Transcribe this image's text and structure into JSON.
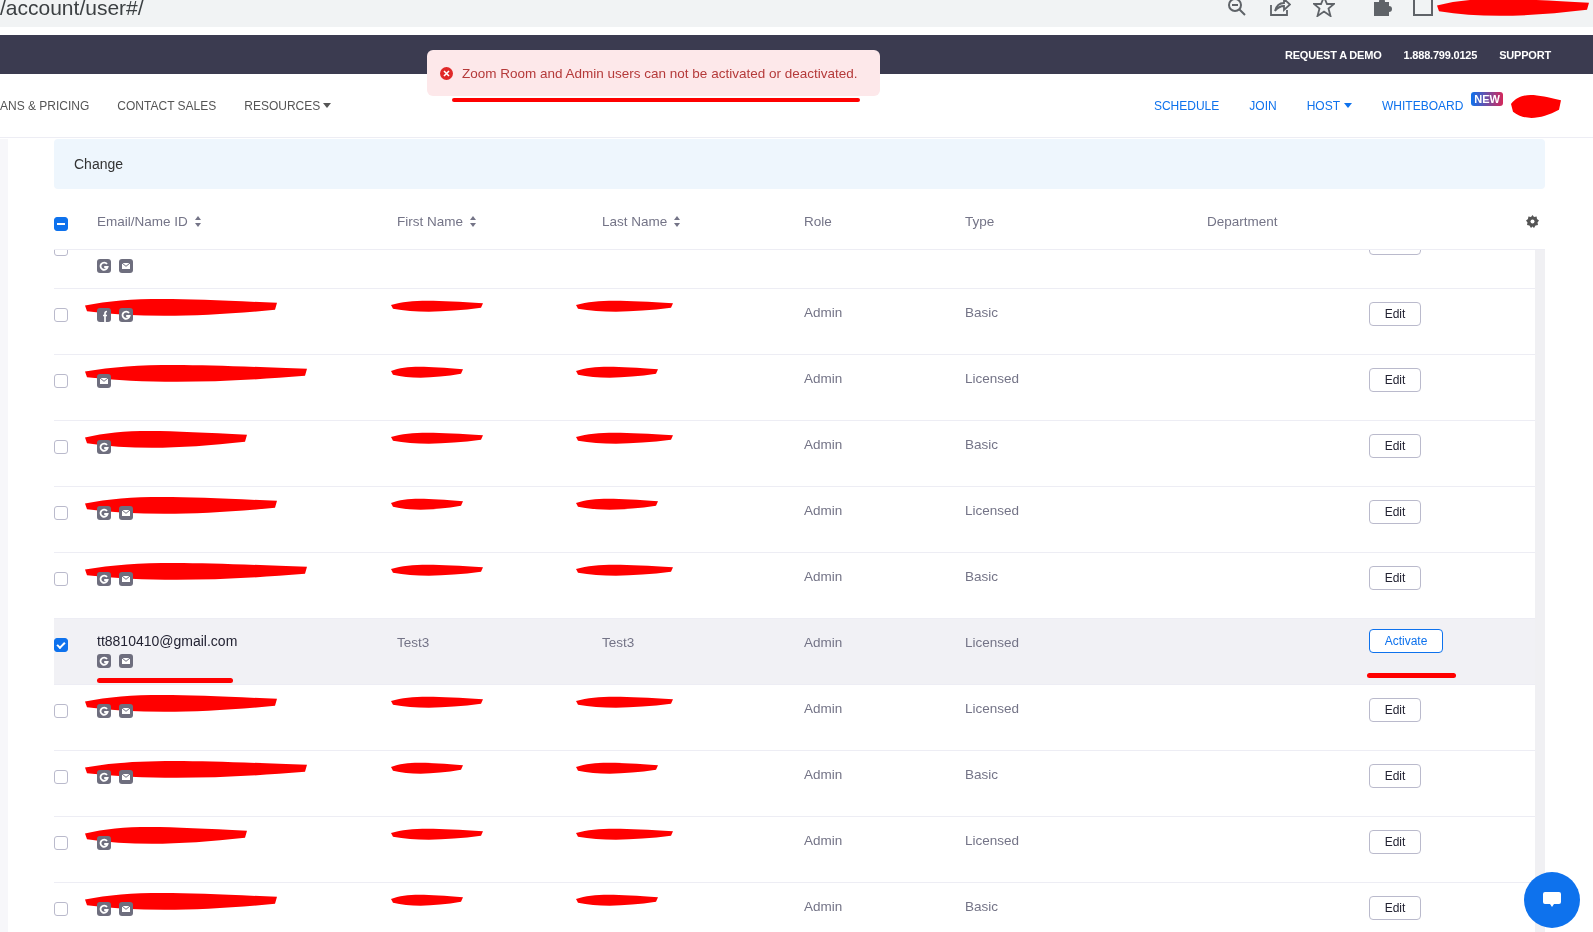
{
  "browser": {
    "url": "/account/user#/",
    "redacted": true
  },
  "top_bar": {
    "links": [
      "REQUEST A DEMO",
      "1.888.799.0125",
      "SUPPORT"
    ]
  },
  "nav": {
    "left": [
      {
        "label": "ANS & PRICING",
        "dropdown": false
      },
      {
        "label": "CONTACT SALES",
        "dropdown": false
      },
      {
        "label": "RESOURCES",
        "dropdown": true
      }
    ],
    "right": [
      {
        "label": "SCHEDULE",
        "dropdown": false
      },
      {
        "label": "JOIN",
        "dropdown": false
      },
      {
        "label": "HOST",
        "dropdown": true
      },
      {
        "label": "WHITEBOARD",
        "dropdown": false,
        "badge": "NEW"
      }
    ],
    "avatar_redacted": true
  },
  "toast": {
    "kind": "error",
    "message": "Zoom Room and Admin users can not be activated or deactivated.",
    "underlined": true
  },
  "action_bar": {
    "label": "Change"
  },
  "table": {
    "partially_selected": true,
    "columns": [
      {
        "label": "Email/Name ID",
        "sortable": true
      },
      {
        "label": "First Name",
        "sortable": true
      },
      {
        "label": "Last Name",
        "sortable": true
      },
      {
        "label": "Role"
      },
      {
        "label": "Type"
      },
      {
        "label": "Department"
      }
    ],
    "rows": [
      {
        "partial": true,
        "selected": false,
        "logins": [
          {
            "kind": "google"
          },
          {
            "kind": "mail"
          }
        ]
      },
      {
        "selected": false,
        "redacted": true,
        "role": "Admin",
        "type": "Basic",
        "action": "Edit",
        "logins": [
          {
            "kind": "facebook"
          },
          {
            "kind": "google"
          }
        ]
      },
      {
        "selected": false,
        "redacted": true,
        "role": "Admin",
        "type": "Licensed",
        "action": "Edit",
        "logins": [
          {
            "kind": "mail"
          }
        ]
      },
      {
        "selected": false,
        "redacted": true,
        "role": "Admin",
        "type": "Basic",
        "action": "Edit",
        "logins": [
          {
            "kind": "google"
          }
        ]
      },
      {
        "selected": false,
        "redacted": true,
        "role": "Admin",
        "type": "Licensed",
        "action": "Edit",
        "logins": [
          {
            "kind": "google"
          },
          {
            "kind": "mail"
          }
        ]
      },
      {
        "selected": false,
        "redacted": true,
        "role": "Admin",
        "type": "Basic",
        "action": "Edit",
        "logins": [
          {
            "kind": "google"
          },
          {
            "kind": "mail"
          }
        ]
      },
      {
        "selected": true,
        "redacted": false,
        "annotated": true,
        "email": "tt8810410@gmail.com",
        "first_name": "Test3",
        "last_name": "Test3",
        "role": "Admin",
        "type": "Licensed",
        "action": "Activate",
        "logins": [
          {
            "kind": "google"
          },
          {
            "kind": "mail"
          }
        ]
      },
      {
        "selected": false,
        "redacted": true,
        "role": "Admin",
        "type": "Licensed",
        "action": "Edit",
        "logins": [
          {
            "kind": "google"
          },
          {
            "kind": "mail"
          }
        ]
      },
      {
        "selected": false,
        "redacted": true,
        "role": "Admin",
        "type": "Basic",
        "action": "Edit",
        "logins": [
          {
            "kind": "google"
          },
          {
            "kind": "mail"
          }
        ]
      },
      {
        "selected": false,
        "redacted": true,
        "role": "Admin",
        "type": "Licensed",
        "action": "Edit",
        "logins": [
          {
            "kind": "google"
          }
        ]
      },
      {
        "selected": false,
        "redacted": true,
        "role": "Admin",
        "type": "Basic",
        "action": "Edit",
        "logins": [
          {
            "kind": "google"
          },
          {
            "kind": "mail"
          }
        ]
      }
    ]
  }
}
